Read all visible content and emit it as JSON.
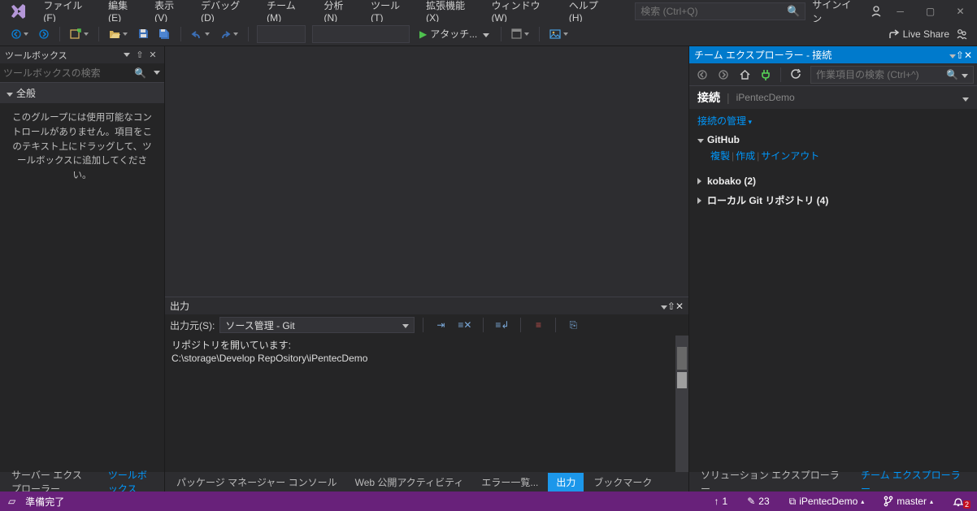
{
  "menu": {
    "file": "ファイル(F)",
    "edit": "編集(E)",
    "view": "表示(V)",
    "debug": "デバッグ(D)",
    "team": "チーム(M)",
    "analyze": "分析(N)",
    "tools": "ツール(T)",
    "extensions": "拡張機能(X)",
    "window": "ウィンドウ(W)",
    "help": "ヘルプ(H)"
  },
  "search": {
    "placeholder": "検索 (Ctrl+Q)"
  },
  "header": {
    "signin": "サインイン",
    "liveshare": "Live Share"
  },
  "toolbar": {
    "attach": "アタッチ..."
  },
  "toolbox": {
    "title": "ツールボックス",
    "search_placeholder": "ツールボックスの検索",
    "group": "全般",
    "emptytext": "このグループには使用可能なコントロールがありません。項目をこのテキスト上にドラッグして、ツールボックスに追加してください。"
  },
  "output": {
    "title": "出力",
    "source_label": "出力元(S):",
    "source_value": "ソース管理 - Git",
    "line1": "リポジトリを開いています:",
    "line2": "C:\\storage\\Develop RepOsitory\\iPentecDemo"
  },
  "bottom_tabs_left": {
    "server_explorer": "サーバー エクスプローラー",
    "toolbox": "ツールボックス"
  },
  "bottom_tabs_center": {
    "pkg_console": "パッケージ マネージャー コンソール",
    "web_publish": "Web 公開アクティビティ",
    "error_list": "エラー一覧...",
    "output": "出力",
    "bookmarks": "ブックマーク"
  },
  "bottom_tabs_right": {
    "solution_explorer": "ソリューション エクスプローラー",
    "team_explorer": "チーム エクスプローラー"
  },
  "team": {
    "title": "チーム エクスプローラー - 接続",
    "search_placeholder": "作業項目の検索 (Ctrl+^)",
    "connect_label": "接続",
    "connect_sub": "iPentecDemo",
    "manage": "接続の管理",
    "github": "GitHub",
    "gh_clone": "複製",
    "gh_create": "作成",
    "gh_signout": "サインアウト",
    "kobako": "kobako (2)",
    "local": "ローカル Git リポジトリ (4)"
  },
  "status": {
    "ready": "準備完了",
    "pushcount": "1",
    "pending": "23",
    "repo": "iPentecDemo",
    "branch": "master",
    "notif": "2"
  }
}
